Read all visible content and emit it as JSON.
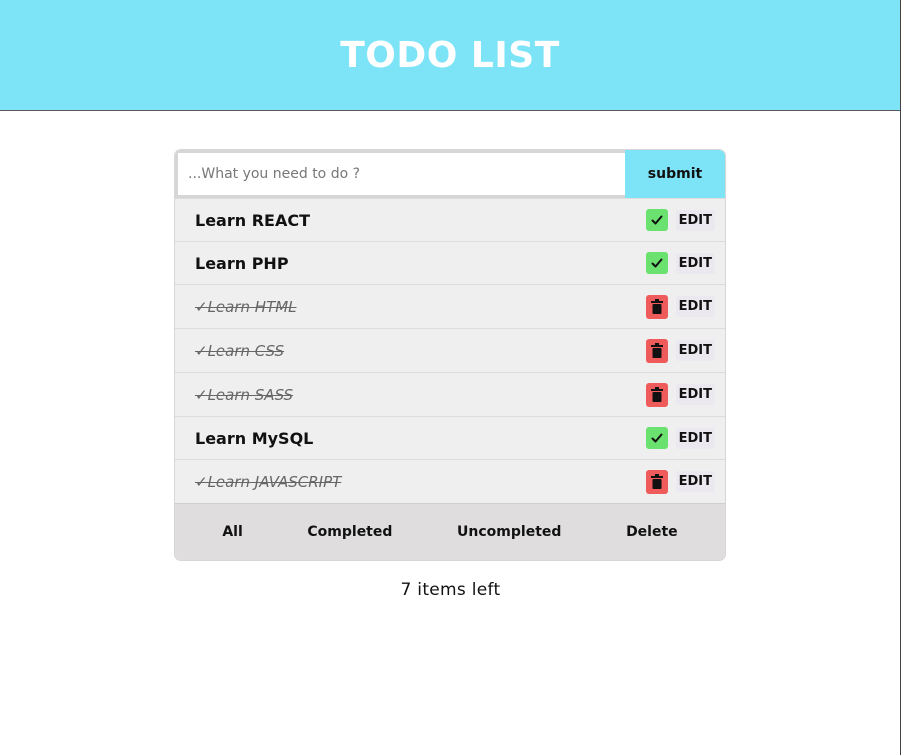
{
  "header": {
    "title": "TODO LIST"
  },
  "form": {
    "input_placeholder": "...What you need to do ?",
    "input_value": "",
    "submit_label": "submit"
  },
  "todos": [
    {
      "label": "Learn REACT",
      "done": false,
      "edit_label": "EDIT",
      "action_icon": "check-icon"
    },
    {
      "label": "Learn PHP",
      "done": false,
      "edit_label": "EDIT",
      "action_icon": "check-icon"
    },
    {
      "label": "✓Learn HTML",
      "done": true,
      "edit_label": "EDIT",
      "action_icon": "trash-icon"
    },
    {
      "label": "✓Learn CSS",
      "done": true,
      "edit_label": "EDIT",
      "action_icon": "trash-icon"
    },
    {
      "label": "✓Learn SASS",
      "done": true,
      "edit_label": "EDIT",
      "action_icon": "trash-icon"
    },
    {
      "label": "Learn MySQL",
      "done": false,
      "edit_label": "EDIT",
      "action_icon": "check-icon"
    },
    {
      "label": "✓Learn JAVASCRIPT",
      "done": true,
      "edit_label": "EDIT",
      "action_icon": "trash-icon"
    }
  ],
  "filters": {
    "all": "All",
    "completed": "Completed",
    "uncompleted": "Uncompleted",
    "delete": "Delete"
  },
  "footer": {
    "items_left": "7 items left"
  },
  "colors": {
    "header_bg": "#7de3f7",
    "check_green": "#6be26f",
    "trash_red": "#ef5b5b",
    "filter_bar_bg": "#dfdddd",
    "list_bg": "#efefef"
  }
}
